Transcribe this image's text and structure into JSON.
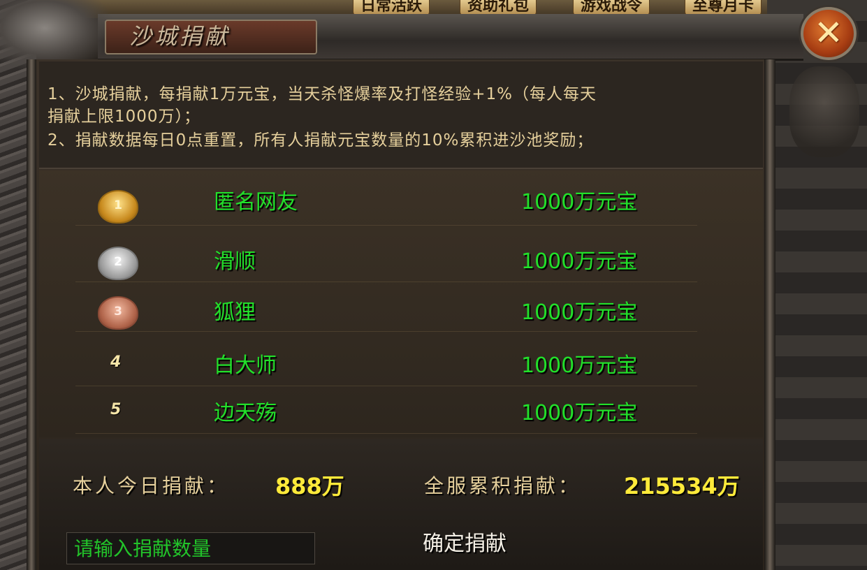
{
  "top_menu": {
    "tabs": [
      "日常活跃",
      "资助礼包",
      "游戏战令",
      "至尊月卡"
    ]
  },
  "window": {
    "title": "沙城捐献",
    "close_icon": "close-x-icon"
  },
  "rules": {
    "line1a": "1、沙城捐献，每捐献1万元宝，当天杀怪爆率及打怪经验+1%（每人每天",
    "line1b": "捐献上限1000万）；",
    "line2": "2、捐献数据每日0点重置，所有人捐献元宝数量的10%累积进沙池奖励；"
  },
  "ranking": [
    {
      "rank": "1",
      "medal": "gold-medal-icon",
      "name": "匿名网友",
      "amount": "1000万元宝"
    },
    {
      "rank": "2",
      "medal": "silver-medal-icon",
      "name": "滑顺",
      "amount": "1000万元宝"
    },
    {
      "rank": "3",
      "medal": "bronze-medal-icon",
      "name": "狐狸",
      "amount": "1000万元宝"
    },
    {
      "rank": "4",
      "medal": "",
      "name": "白大师",
      "amount": "1000万元宝"
    },
    {
      "rank": "5",
      "medal": "",
      "name": "边天殇",
      "amount": "1000万元宝"
    }
  ],
  "stats": {
    "my_label": "本人今日捐献：",
    "my_value": "888万",
    "server_label": "全服累积捐献：",
    "server_value": "215534万"
  },
  "form": {
    "input_placeholder": "请输入捐献数量",
    "confirm_label": "确定捐献"
  },
  "colors": {
    "name_green": "#22e02a",
    "value_yellow": "#ffea3a",
    "text_tan": "#e6d09c"
  }
}
